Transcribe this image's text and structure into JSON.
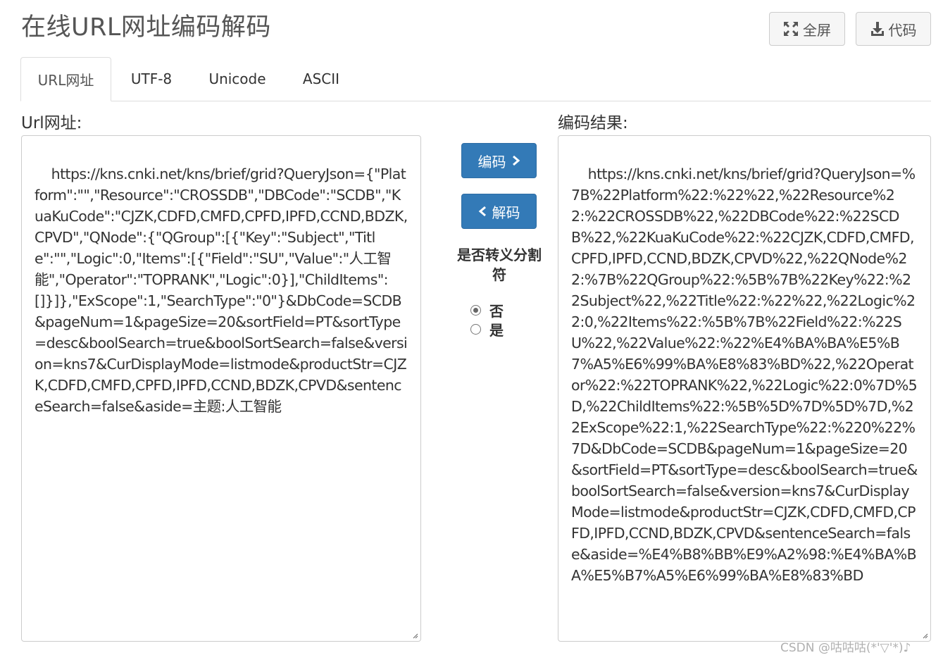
{
  "header": {
    "title": "在线URL网址编码解码",
    "fullscreen_label": "全屏",
    "fullscreen_icon": "expand-icon",
    "code_label": "代码",
    "code_icon": "download-icon"
  },
  "tabs": [
    {
      "label": "URL网址",
      "active": true
    },
    {
      "label": "UTF-8",
      "active": false
    },
    {
      "label": "Unicode",
      "active": false
    },
    {
      "label": "ASCII",
      "active": false
    }
  ],
  "input": {
    "label": "Url网址:",
    "value": "https://kns.cnki.net/kns/brief/grid?QueryJson={\"Platform\":\"\",\"Resource\":\"CROSSDB\",\"DBCode\":\"SCDB\",\"KuaKuCode\":\"CJZK,CDFD,CMFD,CPFD,IPFD,CCND,BDZK,CPVD\",\"QNode\":{\"QGroup\":[{\"Key\":\"Subject\",\"Title\":\"\",\"Logic\":0,\"Items\":[{\"Field\":\"SU\",\"Value\":\"人工智能\",\"Operator\":\"TOPRANK\",\"Logic\":0}],\"ChildItems\":[]}]},\"ExScope\":1,\"SearchType\":\"0\"}&DbCode=SCDB&pageNum=1&pageSize=20&sortField=PT&sortType=desc&boolSearch=true&boolSortSearch=false&version=kns7&CurDisplayMode=listmode&productStr=CJZK,CDFD,CMFD,CPFD,IPFD,CCND,BDZK,CPVD&sentenceSearch=false&aside=主题:人工智能"
  },
  "actions": {
    "encode_label": "编码",
    "decode_label": "解码",
    "separator_label": "是否转义分割符",
    "options": [
      {
        "label": "否",
        "checked": true
      },
      {
        "label": "是",
        "checked": false
      }
    ]
  },
  "output": {
    "label": "编码结果:",
    "value": "https://kns.cnki.net/kns/brief/grid?QueryJson=%7B%22Platform%22:%22%22,%22Resource%22:%22CROSSDB%22,%22DBCode%22:%22SCDB%22,%22KuaKuCode%22:%22CJZK,CDFD,CMFD,CPFD,IPFD,CCND,BDZK,CPVD%22,%22QNode%22:%7B%22QGroup%22:%5B%7B%22Key%22:%22Subject%22,%22Title%22:%22%22,%22Logic%22:0,%22Items%22:%5B%7B%22Field%22:%22SU%22,%22Value%22:%22%E4%BA%BA%E5%B7%A5%E6%99%BA%E8%83%BD%22,%22Operator%22:%22TOPRANK%22,%22Logic%22:0%7D%5D,%22ChildItems%22:%5B%5D%7D%5D%7D,%22ExScope%22:1,%22SearchType%22:%220%22%7D&DbCode=SCDB&pageNum=1&pageSize=20&sortField=PT&sortType=desc&boolSearch=true&boolSortSearch=false&version=kns7&CurDisplayMode=listmode&productStr=CJZK,CDFD,CMFD,CPFD,IPFD,CCND,BDZK,CPVD&sentenceSearch=false&aside=%E4%B8%BB%E9%A2%98:%E4%BA%BA%E5%B7%A5%E6%99%BA%E8%83%BD"
  },
  "watermark": "CSDN @咕咕咕(*'▽'*)♪",
  "colors": {
    "primary": "#337ab7",
    "border": "#cccccc",
    "text": "#333333"
  }
}
